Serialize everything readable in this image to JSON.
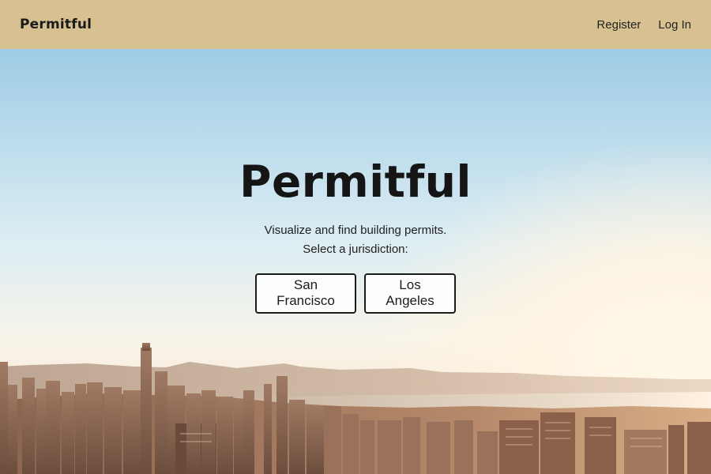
{
  "header": {
    "brand": "Permitful",
    "nav": {
      "register": "Register",
      "login": "Log In"
    }
  },
  "hero": {
    "title": "Permitful",
    "tagline": "Visualize and find building permits.",
    "prompt": "Select a jurisdiction:",
    "jurisdictions": [
      "San Francisco",
      "Los Angeles"
    ]
  },
  "colors": {
    "header_bg": "#d7c190",
    "text": "#151515",
    "button_border": "#1c1c1c"
  }
}
